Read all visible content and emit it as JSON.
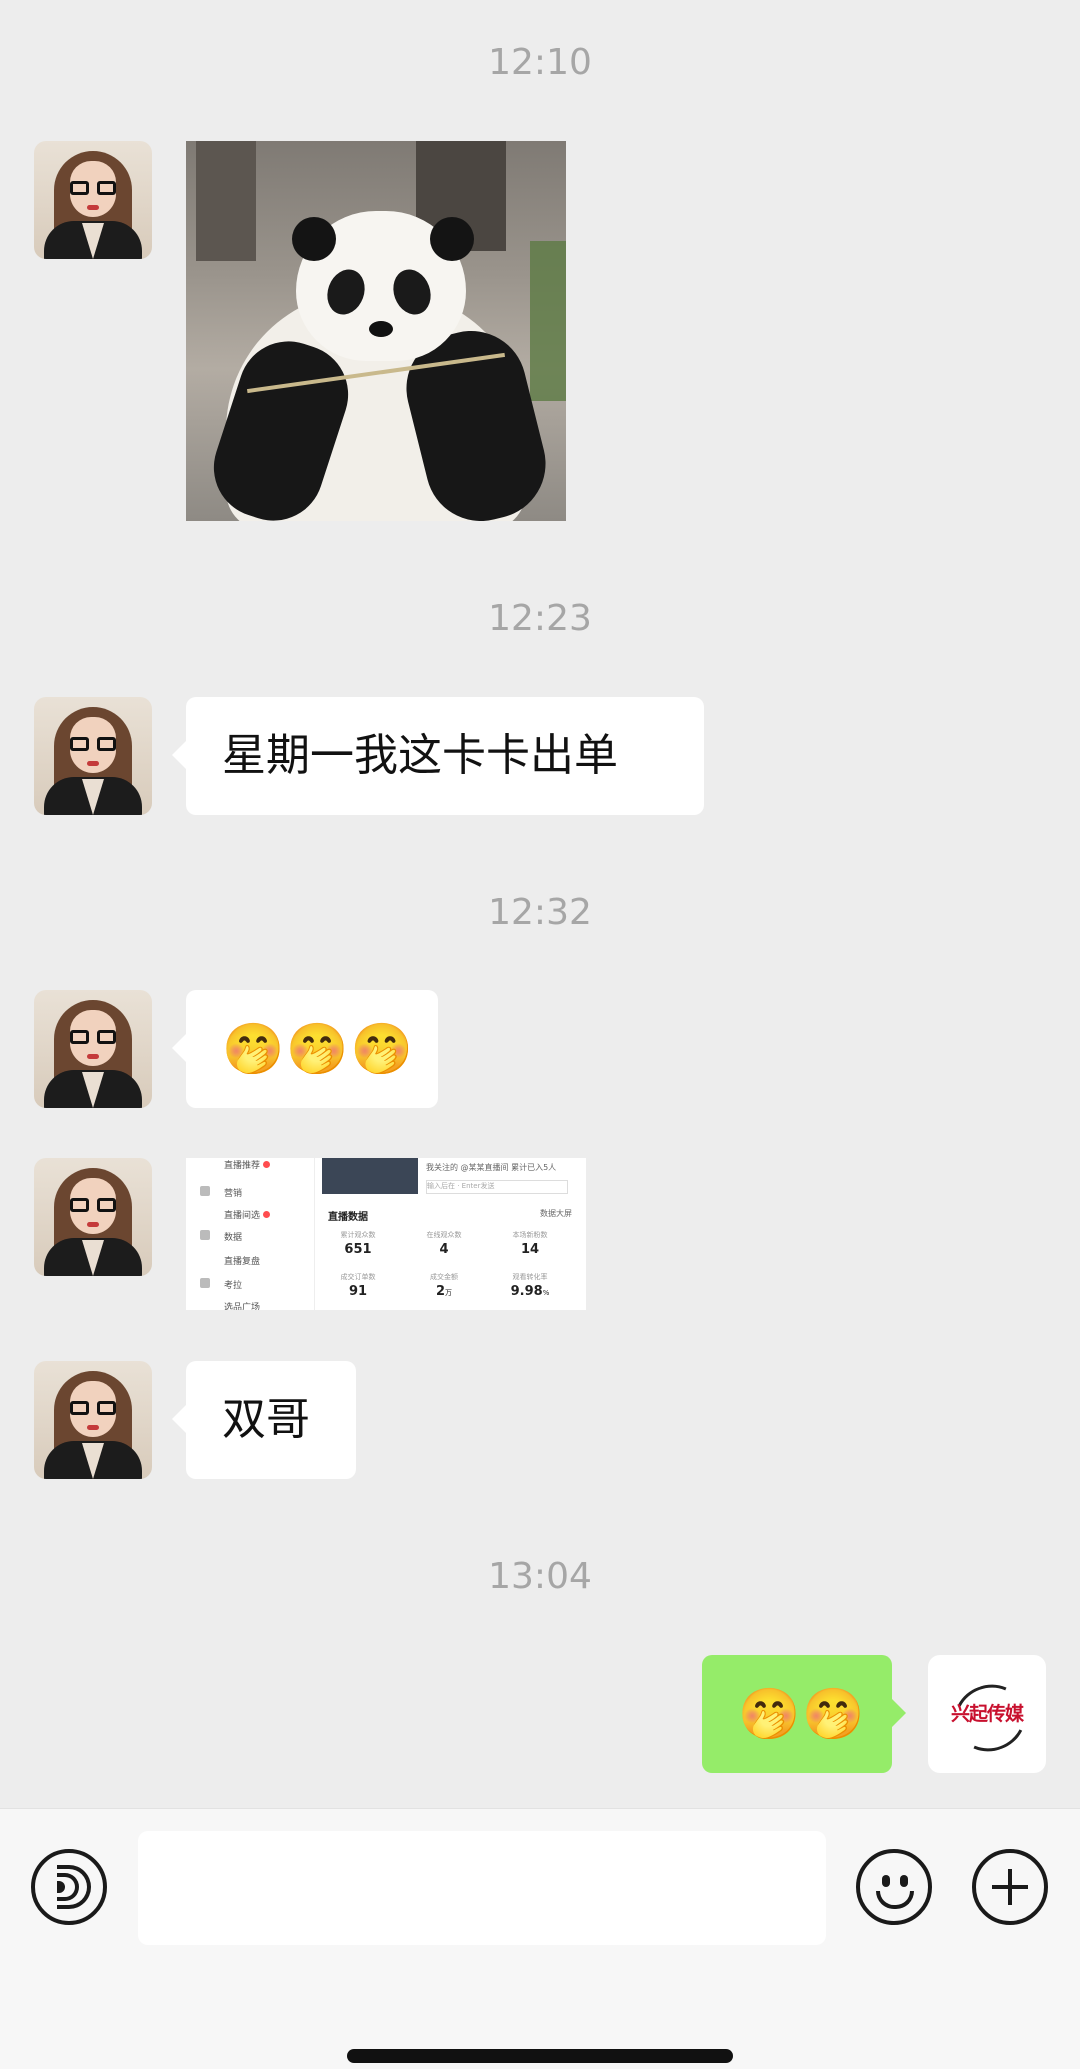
{
  "messages": {
    "times": [
      "12:10",
      "12:23",
      "12:32",
      "13:04"
    ],
    "text_1": "星期一我这卡卡出单",
    "emoji_1": "🤭🤭🤭",
    "text_2": "双哥",
    "emoji_out": "🤭🤭"
  },
  "screenshot": {
    "nav_items": [
      "直播推荐",
      "营销",
      "直播间选",
      "数据",
      "直播复盘",
      "考拉",
      "选品广场"
    ],
    "top_line": "我关注的 @某某直播间 累计已入5人",
    "input_line": "输入后在 · Enter发送",
    "panel_title": "直播数据",
    "panel_link": "数据大屏",
    "stats": [
      {
        "label": "累计观众数",
        "value": "651",
        "unit": ""
      },
      {
        "label": "在线观众数",
        "value": "4",
        "unit": ""
      },
      {
        "label": "本场新粉数",
        "value": "14",
        "unit": ""
      },
      {
        "label": "成交订单数",
        "value": "91",
        "unit": ""
      },
      {
        "label": "成交金额",
        "value": "2",
        "unit": "万"
      },
      {
        "label": "观看转化率",
        "value": "9.98",
        "unit": "%"
      }
    ]
  },
  "brand_avatar": {
    "text": "兴起传媒"
  },
  "input": {
    "value": ""
  }
}
